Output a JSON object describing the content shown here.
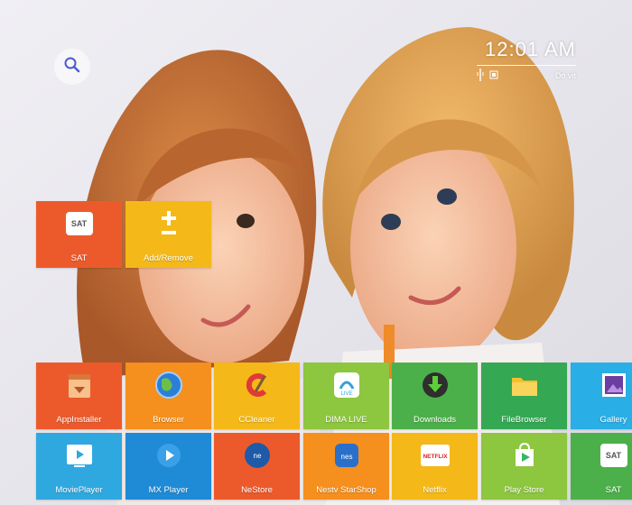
{
  "clock": {
    "time": "12:01 AM",
    "date": "Do vit"
  },
  "search": {
    "icon": "search-icon"
  },
  "top_tiles": [
    {
      "label": "SAT",
      "icon": "sat-icon",
      "color": "#ec5a2c"
    },
    {
      "label": "Add/Remove",
      "icon": "add-remove-icon",
      "color": "#f4b918"
    }
  ],
  "row1": [
    {
      "label": "AppInstaller",
      "icon": "app-installer-icon",
      "color": "#ec5a2c"
    },
    {
      "label": "Browser",
      "icon": "browser-icon",
      "color": "#f58f1e"
    },
    {
      "label": "CCleaner",
      "icon": "ccleaner-icon",
      "color": "#f4b918"
    },
    {
      "label": "DIMA LIVE",
      "icon": "dima-live-icon",
      "color": "#8dc63f"
    },
    {
      "label": "Downloads",
      "icon": "downloads-icon",
      "color": "#4cb04a"
    },
    {
      "label": "FileBrowser",
      "icon": "file-browser-icon",
      "color": "#34a853"
    },
    {
      "label": "Gallery",
      "icon": "gallery-icon",
      "color": "#29aee6"
    }
  ],
  "row2": [
    {
      "label": "MoviePlayer",
      "icon": "movie-player-icon",
      "color": "#2fa8e0"
    },
    {
      "label": "MX Player",
      "icon": "mx-player-icon",
      "color": "#1f8ad6"
    },
    {
      "label": "NeStore",
      "icon": "nestore-icon",
      "color": "#ec5a2c"
    },
    {
      "label": "Nestv StarShop",
      "icon": "nestv-starshop-icon",
      "color": "#f58f1e"
    },
    {
      "label": "Netflix",
      "icon": "netflix-icon",
      "color": "#f4b918"
    },
    {
      "label": "Play Store",
      "icon": "play-store-icon",
      "color": "#8dc63f"
    },
    {
      "label": "SAT",
      "icon": "sat-icon",
      "color": "#4cb04a"
    }
  ],
  "colors": {
    "background": "#e9e8ee",
    "hair": "#c8743a"
  }
}
